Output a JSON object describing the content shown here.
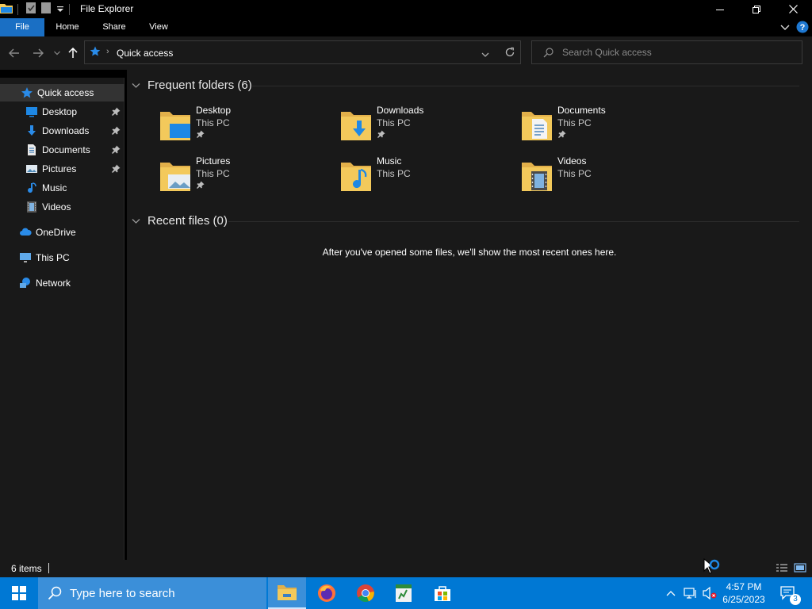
{
  "window": {
    "title": "File Explorer"
  },
  "ribbon": {
    "tabs": [
      {
        "label": "File"
      },
      {
        "label": "Home"
      },
      {
        "label": "Share"
      },
      {
        "label": "View"
      }
    ]
  },
  "address": {
    "location": "Quick access"
  },
  "search": {
    "placeholder": "Search Quick access"
  },
  "sidebar": {
    "items": [
      {
        "label": "Quick access",
        "icon": "star-icon"
      },
      {
        "label": "Desktop",
        "icon": "desktop-icon",
        "pinned": true
      },
      {
        "label": "Downloads",
        "icon": "download-arrow-icon",
        "pinned": true
      },
      {
        "label": "Documents",
        "icon": "document-icon",
        "pinned": true
      },
      {
        "label": "Pictures",
        "icon": "picture-icon",
        "pinned": true
      },
      {
        "label": "Music",
        "icon": "music-note-icon"
      },
      {
        "label": "Videos",
        "icon": "film-icon"
      },
      {
        "label": "OneDrive",
        "icon": "cloud-icon"
      },
      {
        "label": "This PC",
        "icon": "monitor-icon"
      },
      {
        "label": "Network",
        "icon": "network-icon"
      }
    ]
  },
  "frequent": {
    "header": "Frequent folders (6)",
    "folders": [
      {
        "name": "Desktop",
        "location": "This PC",
        "pinned": true,
        "icon": "desktop-folder-icon"
      },
      {
        "name": "Downloads",
        "location": "This PC",
        "pinned": true,
        "icon": "downloads-folder-icon"
      },
      {
        "name": "Documents",
        "location": "This PC",
        "pinned": true,
        "icon": "documents-folder-icon"
      },
      {
        "name": "Pictures",
        "location": "This PC",
        "pinned": true,
        "icon": "pictures-folder-icon"
      },
      {
        "name": "Music",
        "location": "This PC",
        "pinned": false,
        "icon": "music-folder-icon"
      },
      {
        "name": "Videos",
        "location": "This PC",
        "pinned": false,
        "icon": "videos-folder-icon"
      }
    ]
  },
  "recent": {
    "header": "Recent files (0)",
    "empty_message": "After you've opened some files, we'll show the most recent ones here."
  },
  "status": {
    "item_count": "6 items"
  },
  "taskbar": {
    "search_placeholder": "Type here to search",
    "apps": [
      "file-explorer-icon",
      "firefox-icon",
      "chrome-icon",
      "spreadsheet-app-icon",
      "store-icon"
    ],
    "clock_time": "4:57 PM",
    "clock_date": "6/25/2023",
    "notification_count": "3"
  },
  "colors": {
    "accent": "#1a6fc4",
    "taskbar": "#0078d4",
    "folder": "#f3c95b",
    "background": "#191919"
  }
}
